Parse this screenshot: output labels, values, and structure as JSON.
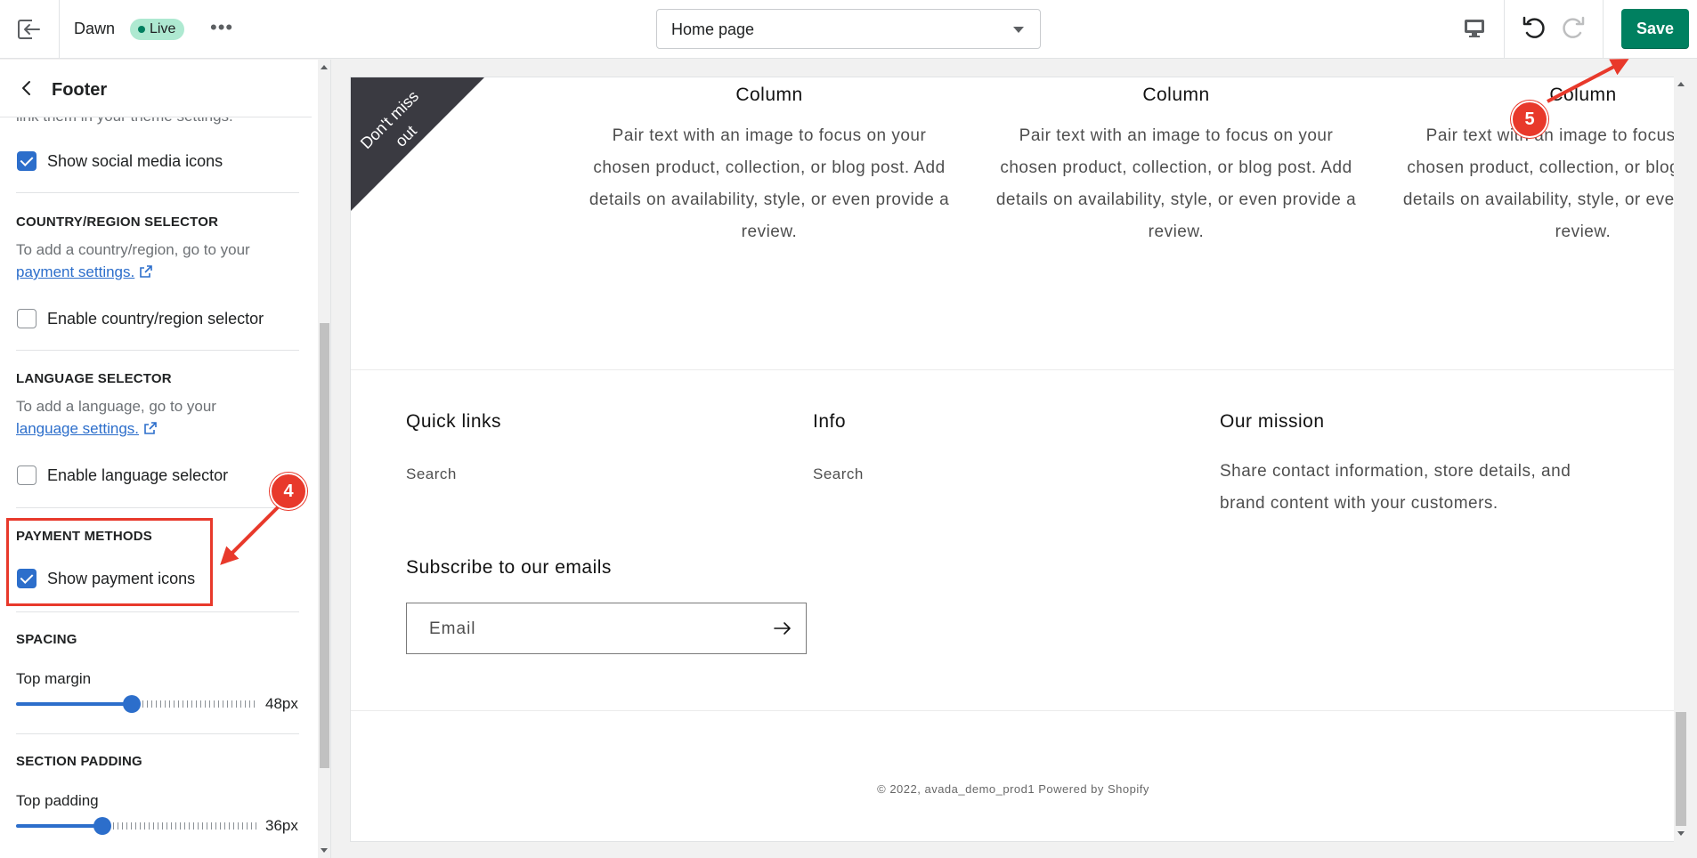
{
  "topbar": {
    "theme_name": "Dawn",
    "live_label": "Live",
    "more_label": "•••",
    "page_select": "Home page",
    "save_label": "Save"
  },
  "sidebar": {
    "back_label": "‹",
    "title": "Footer",
    "cut_text": "link them in your theme settings.",
    "social": {
      "label": "Show social media icons",
      "checked": true
    },
    "country": {
      "heading": "COUNTRY/REGION SELECTOR",
      "help": "To add a country/region, go to your",
      "link": "payment settings.",
      "label": "Enable country/region selector",
      "checked": false
    },
    "language": {
      "heading": "LANGUAGE SELECTOR",
      "help": "To add a language, go to your",
      "link": "language settings.",
      "label": "Enable language selector",
      "checked": false
    },
    "payment": {
      "heading": "PAYMENT METHODS",
      "label": "Show payment icons",
      "checked": true
    },
    "spacing": {
      "heading": "SPACING",
      "label": "Top margin",
      "value": "48px",
      "fraction": 0.48
    },
    "padding": {
      "heading": "SECTION PADDING",
      "label": "Top padding",
      "value": "36px",
      "fraction": 0.36
    }
  },
  "preview": {
    "ribbon_text": "Don't miss out",
    "columns": [
      {
        "title": "Column",
        "text": "Pair text with an image to focus on your chosen product, collection, or blog post. Add details on availability, style, or even provide a review."
      },
      {
        "title": "Column",
        "text": "Pair text with an image to focus on your chosen product, collection, or blog post. Add details on availability, style, or even provide a review."
      },
      {
        "title": "Column",
        "text": "Pair text with an image to focus on your chosen product, collection, or blog post. Add details on availability, style, or even provide a review."
      }
    ],
    "footer": {
      "quick_links": {
        "heading": "Quick links",
        "link": "Search"
      },
      "info": {
        "heading": "Info",
        "link": "Search"
      },
      "mission": {
        "heading": "Our mission",
        "text": "Share contact information, store details, and brand content with your customers."
      },
      "subscribe": {
        "heading": "Subscribe to our emails",
        "placeholder": "Email"
      },
      "copyright": "© 2022, avada_demo_prod1 Powered by Shopify"
    }
  },
  "annotations": {
    "step4": "4",
    "step5": "5",
    "color": "#e8392b"
  },
  "colors": {
    "save": "#008060",
    "accent": "#2c6ecb",
    "live_badge": "#aee9d1"
  }
}
